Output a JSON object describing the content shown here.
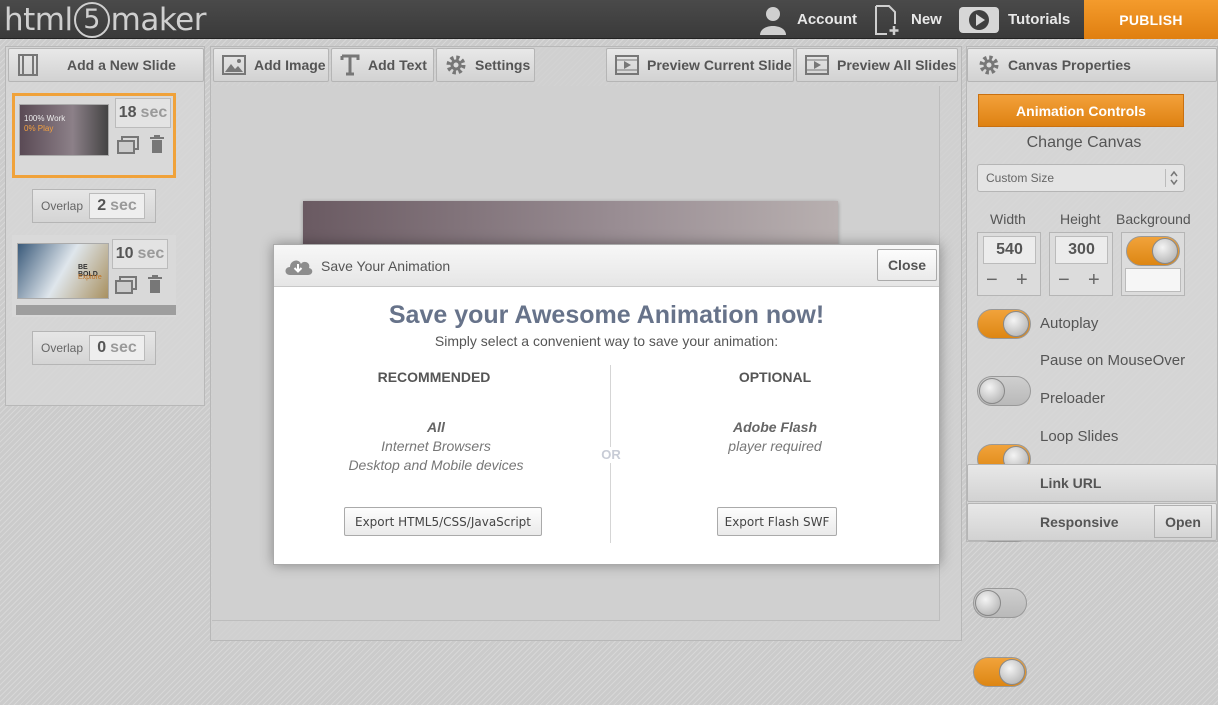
{
  "app": {
    "logo_left": "html",
    "logo_num": "5",
    "logo_right": "maker"
  },
  "header": {
    "account": "Account",
    "new": "New",
    "tutorials": "Tutorials",
    "publish": "PUBLISH"
  },
  "left_panel": {
    "add_slide": "Add a New Slide",
    "slides": [
      {
        "sec": "18",
        "unit": "sec",
        "thumb_line1": "100% Work",
        "thumb_line2": "0% Play",
        "overlap_label": "Overlap",
        "overlap_value": "2",
        "overlap_unit": "sec"
      },
      {
        "sec": "10",
        "unit": "sec",
        "thumb_line1": "BE BOLD",
        "thumb_line2": "Explore",
        "overlap_label": "Overlap",
        "overlap_value": "0",
        "overlap_unit": "sec"
      }
    ]
  },
  "toolbar": {
    "add_image": "Add Image",
    "add_text": "Add Text",
    "settings": "Settings",
    "preview_current": "Preview Current Slide",
    "preview_all": "Preview All Slides"
  },
  "right_panel": {
    "title": "Canvas Properties",
    "animation_controls": "Animation Controls",
    "change_canvas": "Change Canvas",
    "size_select": "Custom Size",
    "width_label": "Width",
    "height_label": "Height",
    "background_label": "Background",
    "width_value": "540",
    "height_value": "300",
    "toggles": [
      {
        "label": "Autoplay",
        "on": true
      },
      {
        "label": "Pause on MouseOver",
        "on": false
      },
      {
        "label": "Preloader",
        "on": true
      },
      {
        "label": "Loop Slides",
        "on": true
      }
    ],
    "link_url": "Link URL",
    "responsive": "Responsive",
    "open": "Open"
  },
  "modal": {
    "title": "Save Your Animation",
    "close": "Close",
    "heading": "Save your Awesome Animation now!",
    "subheading": "Simply select a convenient way to save your animation:",
    "or": "OR",
    "left": {
      "label": "RECOMMENDED",
      "line1": "All",
      "line2": "Internet Browsers",
      "line3": "Desktop and Mobile devices",
      "button": "Export HTML5/CSS/JavaScript"
    },
    "right": {
      "label": "OPTIONAL",
      "line1": "Adobe Flash",
      "line2": "player required",
      "button": "Export Flash SWF"
    }
  },
  "colors": {
    "accent": "#e8891a",
    "header_bg": "#3f3f3f",
    "modal_heading": "#67738a"
  }
}
